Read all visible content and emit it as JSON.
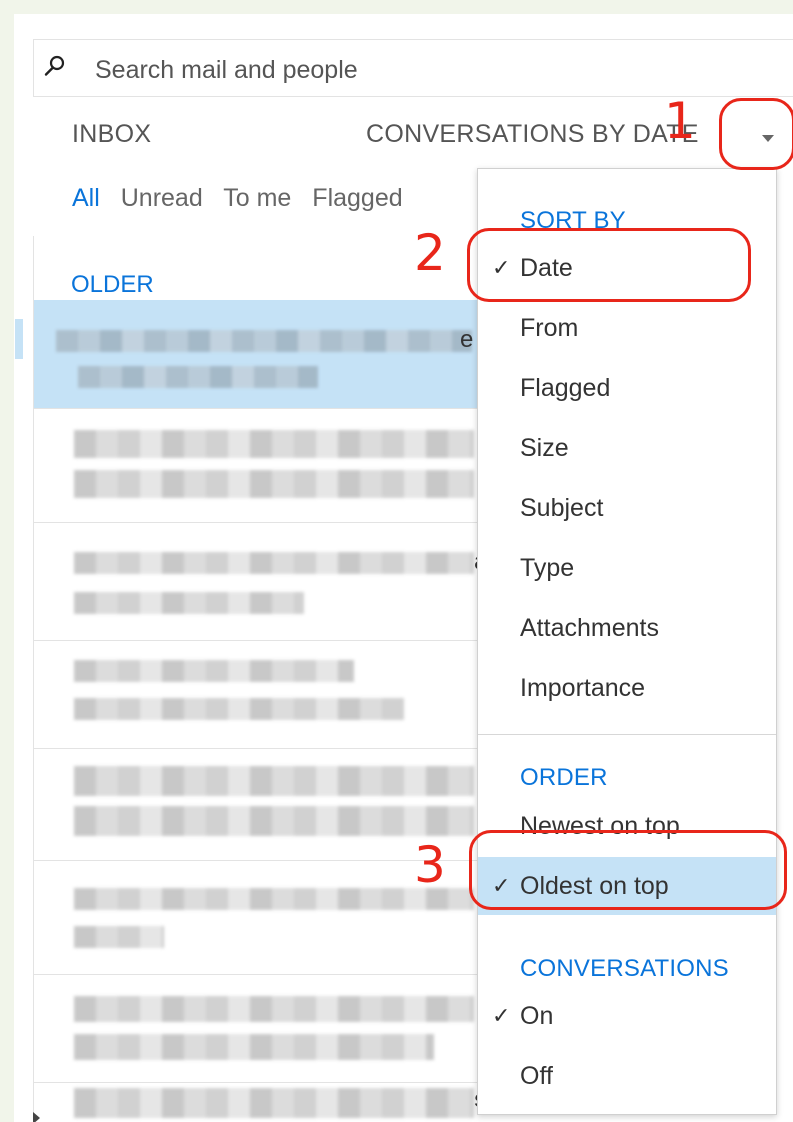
{
  "search": {
    "placeholder": "Search mail and people"
  },
  "header": {
    "folder": "INBOX",
    "view_mode": "CONVERSATIONS BY DATE"
  },
  "filters": [
    "All",
    "Unread",
    "To me",
    "Flagged"
  ],
  "list": {
    "section_header": "OLDER",
    "partial_chars": [
      "e",
      "a",
      "s"
    ]
  },
  "dropdown": {
    "sort_by": {
      "title": "SORT BY",
      "items": [
        "Date",
        "From",
        "Flagged",
        "Size",
        "Subject",
        "Type",
        "Attachments",
        "Importance"
      ],
      "selected": "Date"
    },
    "order": {
      "title": "ORDER",
      "items": [
        "Newest on top",
        "Oldest on top"
      ],
      "selected": "Oldest on top"
    },
    "conversations": {
      "title": "CONVERSATIONS",
      "items": [
        "On",
        "Off"
      ],
      "selected": "On"
    }
  },
  "annotations": {
    "labels": [
      "1",
      "2",
      "3"
    ],
    "color": "#e8261a"
  },
  "colors": {
    "accent": "#0a74da",
    "highlight": "#c5e2f6",
    "background": "#f1f5ea"
  },
  "icons": {
    "search": "search-icon",
    "caret": "chevron-down-icon",
    "check": "checkmark-icon",
    "expand": "triangle-right-icon"
  }
}
